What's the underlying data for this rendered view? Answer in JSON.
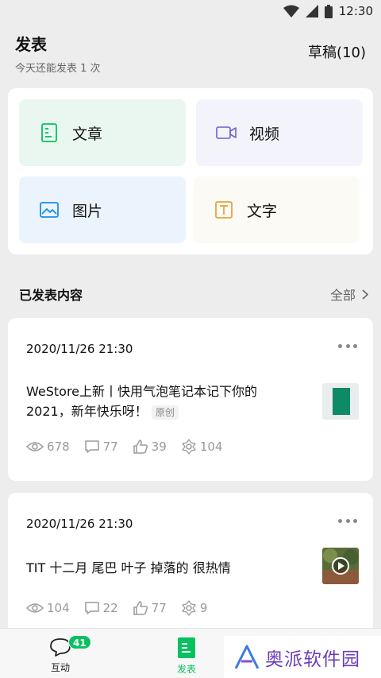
{
  "status_bar": {
    "time": "12:30"
  },
  "header": {
    "title": "发表",
    "subtitle": "今天还能发表 1 次",
    "drafts": "草稿(10)"
  },
  "create": {
    "article": "文章",
    "video": "视频",
    "image": "图片",
    "text": "文字"
  },
  "published": {
    "label": "已发表内容",
    "all": "全部"
  },
  "posts": [
    {
      "date": "2020/11/26 21:30",
      "title_line1": "WeStore上新丨快用气泡笔记本记下你的",
      "title_line2": "2021，新年快乐呀！",
      "tag": "原创",
      "views": "678",
      "comments": "77",
      "likes": "39",
      "shares": "104"
    },
    {
      "date": "2020/11/26 21:30",
      "title_line1": "TIT 十二月 尾巴 叶子 掉落的 很热情",
      "views": "104",
      "comments": "22",
      "likes": "77",
      "shares": "9"
    }
  ],
  "tabbar": {
    "interact": "互动",
    "interact_badge": "41",
    "publish": "发表"
  },
  "watermark": {
    "text": "奥派软件园"
  },
  "colors": {
    "accent": "#07c160",
    "watermark": "#6a3db8"
  }
}
